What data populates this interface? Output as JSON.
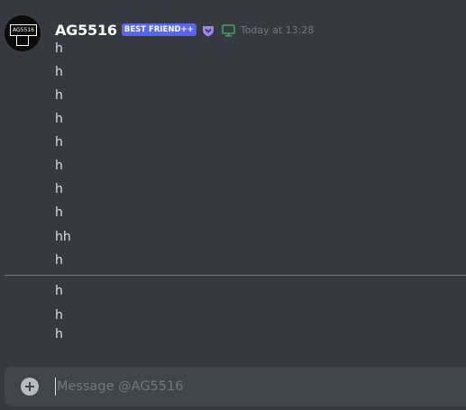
{
  "message_group": {
    "username": "AG5516",
    "tag": "BEST FRIEND++",
    "badge_icon": "nitro-shield-icon",
    "device_icon": "desktop-icon",
    "timestamp": "Today at 13:28",
    "avatar_text": "AG5516",
    "accent_colors": {
      "tag_bg": "#5865f2",
      "badge": "#9b84ec",
      "device": "#3ba55d",
      "new_divider": "#ed4245"
    }
  },
  "messages_before_divider": [
    "h",
    "h",
    "h",
    "h",
    "h",
    "h",
    "h",
    "h",
    "hh",
    "h"
  ],
  "messages_after_divider": [
    "h",
    "h",
    "h"
  ],
  "composer": {
    "placeholder": "Message @AG5516",
    "value": ""
  }
}
